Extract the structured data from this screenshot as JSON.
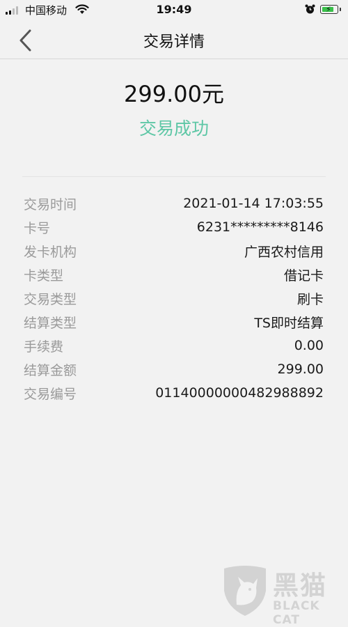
{
  "status_bar": {
    "carrier": "中国移动",
    "time": "19:49",
    "battery_level": 0.85,
    "battery_color": "#39c04a"
  },
  "nav": {
    "back_icon": "chevron-left-icon",
    "title": "交易详情"
  },
  "summary": {
    "amount": "299.00元",
    "status": "交易成功",
    "status_color": "#5ec7a6"
  },
  "details": [
    {
      "label": "交易时间",
      "value": "2021-01-14 17:03:55"
    },
    {
      "label": "卡号",
      "value": "6231*********8146"
    },
    {
      "label": "发卡机构",
      "value": "广西农村信用"
    },
    {
      "label": "卡类型",
      "value": "借记卡"
    },
    {
      "label": "交易类型",
      "value": "刷卡"
    },
    {
      "label": "结算类型",
      "value": "TS即时结算"
    },
    {
      "label": "手续费",
      "value": "0.00"
    },
    {
      "label": "结算金额",
      "value": "299.00"
    },
    {
      "label": "交易编号",
      "value": "01140000000482988892"
    }
  ],
  "watermark": {
    "cn": "黑猫",
    "en": "BLACK CAT",
    "icon": "cat-shield-icon"
  }
}
